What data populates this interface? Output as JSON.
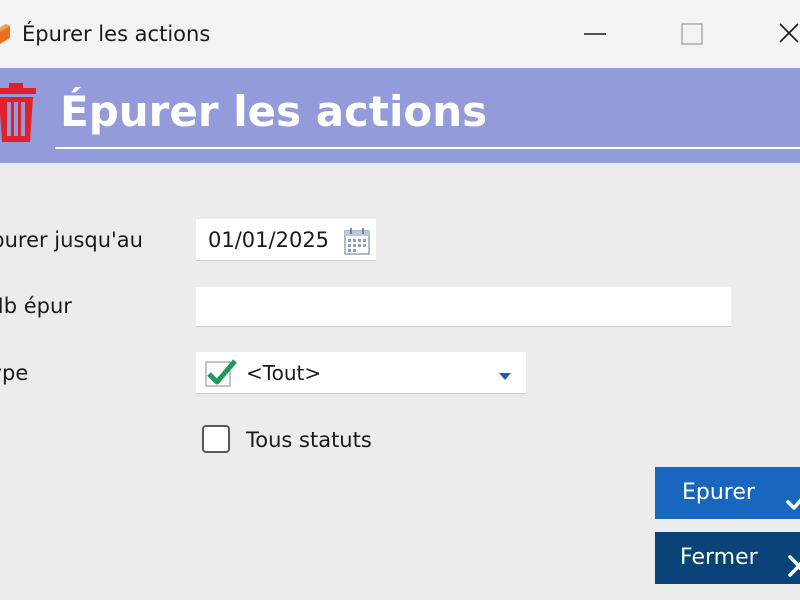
{
  "window": {
    "title": "Épurer les actions",
    "controls": {
      "minimize": "minimize-icon",
      "maximize": "maximize-icon",
      "close": "close-icon"
    }
  },
  "header": {
    "title": "Épurer les actions",
    "icon": "trash-icon",
    "background_color": "#939bdb",
    "icon_color": "#e0202a"
  },
  "form": {
    "date": {
      "label": "Épurer jusqu'au",
      "value": "01/01/2025",
      "icon": "calendar-icon"
    },
    "nb": {
      "label": "Nb épur",
      "value": ""
    },
    "type": {
      "label": "Type",
      "selected": "<Tout>",
      "icon": "check-icon"
    },
    "all_statuses": {
      "label": "Tous statuts",
      "checked": false
    }
  },
  "buttons": {
    "epurer": {
      "label": "Epurer",
      "icon": "checkmark-icon",
      "color": "#1767bf"
    },
    "fermer": {
      "label": "Fermer",
      "icon": "close-x-icon",
      "color": "#0a4378"
    }
  }
}
